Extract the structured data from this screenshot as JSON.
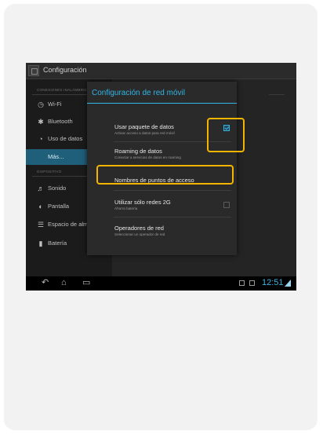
{
  "app": {
    "title": "Configuración"
  },
  "sidebar": {
    "section_wireless": "CONEXIONES INALÁMBRIC",
    "section_device": "DISPOSITIVO",
    "items": [
      {
        "label": "Wi-Fi",
        "icon": "wifi-icon"
      },
      {
        "label": "Bluetooth",
        "icon": "bluetooth-icon"
      },
      {
        "label": "Uso de datos",
        "icon": "data-usage-icon"
      },
      {
        "label": "Más...",
        "icon": "",
        "active": true
      },
      {
        "label": "Sonido",
        "icon": "sound-icon"
      },
      {
        "label": "Pantalla",
        "icon": "display-icon"
      },
      {
        "label": "Espacio de almac",
        "icon": "storage-icon"
      },
      {
        "label": "Batería",
        "icon": "battery-icon"
      }
    ]
  },
  "dialog": {
    "title": "Configuración de red móvil",
    "options": [
      {
        "title": "Usar paquete de datos",
        "summary": "Activar acceso a datos para red móvil",
        "checkbox": true,
        "checked": true
      },
      {
        "title": "Roaming de datos",
        "summary": "Conectar a servicios de datos en roaming",
        "checkbox": false,
        "checked": false
      },
      {
        "title": "Nombres de puntos de acceso",
        "summary": "",
        "checkbox": false,
        "checked": false
      },
      {
        "title": "Utilizar sólo redes 2G",
        "summary": "Ahorra batería",
        "checkbox": true,
        "checked": false
      },
      {
        "title": "Operadores de red",
        "summary": "Seleccionar un operador de red",
        "checkbox": false,
        "checked": false
      }
    ]
  },
  "status_bar": {
    "time": "12:51"
  },
  "colors": {
    "accent": "#33b5e5",
    "highlight": "#f4b400",
    "background": "#1b1b1b"
  }
}
